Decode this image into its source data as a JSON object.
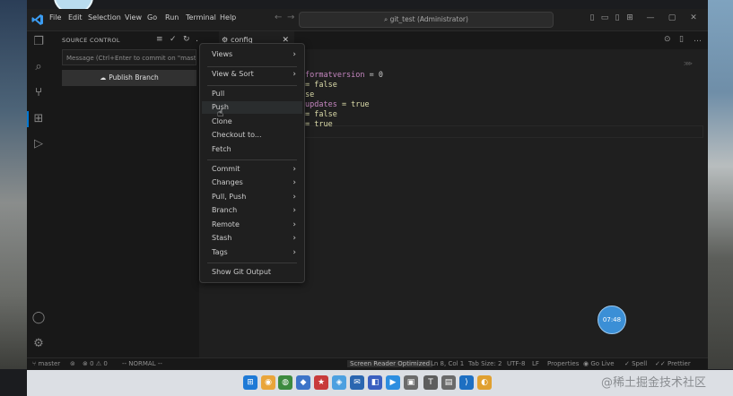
{
  "titlebar": {
    "menus": [
      "File",
      "Edit",
      "Selection",
      "View",
      "Go",
      "Run",
      "Terminal",
      "Help"
    ],
    "search_text": "git_test (Administrator)"
  },
  "sidebar": {
    "title": "SOURCE CONTROL",
    "message_placeholder": "Message (Ctrl+Enter to commit on \"master\")",
    "publish_label": "Publish Branch"
  },
  "tab": {
    "label": "config"
  },
  "code_lines": [
    {
      "a": "formatversion",
      "b": " = 0"
    },
    {
      "a": "",
      "b": "= false"
    },
    {
      "a": "",
      "b": "se"
    },
    {
      "a": "updates",
      "b": " = true"
    },
    {
      "a": "",
      "b": "= false"
    },
    {
      "a": "",
      "b": "= true"
    }
  ],
  "context_menu": {
    "items": [
      {
        "label": "Views",
        "submenu": true
      },
      {
        "label": "View & Sort",
        "submenu": true
      },
      {
        "label": "Pull",
        "submenu": false
      },
      {
        "label": "Push",
        "submenu": false,
        "hover": true
      },
      {
        "label": "Clone",
        "submenu": false
      },
      {
        "label": "Checkout to...",
        "submenu": false
      },
      {
        "label": "Fetch",
        "submenu": false
      },
      {
        "label": "Commit",
        "submenu": true
      },
      {
        "label": "Changes",
        "submenu": true
      },
      {
        "label": "Pull, Push",
        "submenu": true
      },
      {
        "label": "Branch",
        "submenu": true
      },
      {
        "label": "Remote",
        "submenu": true
      },
      {
        "label": "Stash",
        "submenu": true
      },
      {
        "label": "Tags",
        "submenu": true
      },
      {
        "label": "Show Git Output",
        "submenu": false
      }
    ]
  },
  "bubble": {
    "time": "07:48"
  },
  "statusbar": {
    "branch": "master",
    "problems": "0",
    "warnings": "0",
    "mode": "-- NORMAL --",
    "screen_reader": "Screen Reader Optimized",
    "position": "Ln 8, Col 1",
    "tab_size": "Tab Size: 2",
    "encoding": "UTF-8",
    "eol": "LF",
    "language": "Properties",
    "golive": "Go Live",
    "spell": "Spell",
    "prettier": "Prettier"
  },
  "watermark": {
    "text": "@稀土掘金技术社区"
  },
  "colors": {
    "accent": "#0078d4",
    "bubble": "#3b8fd6"
  }
}
